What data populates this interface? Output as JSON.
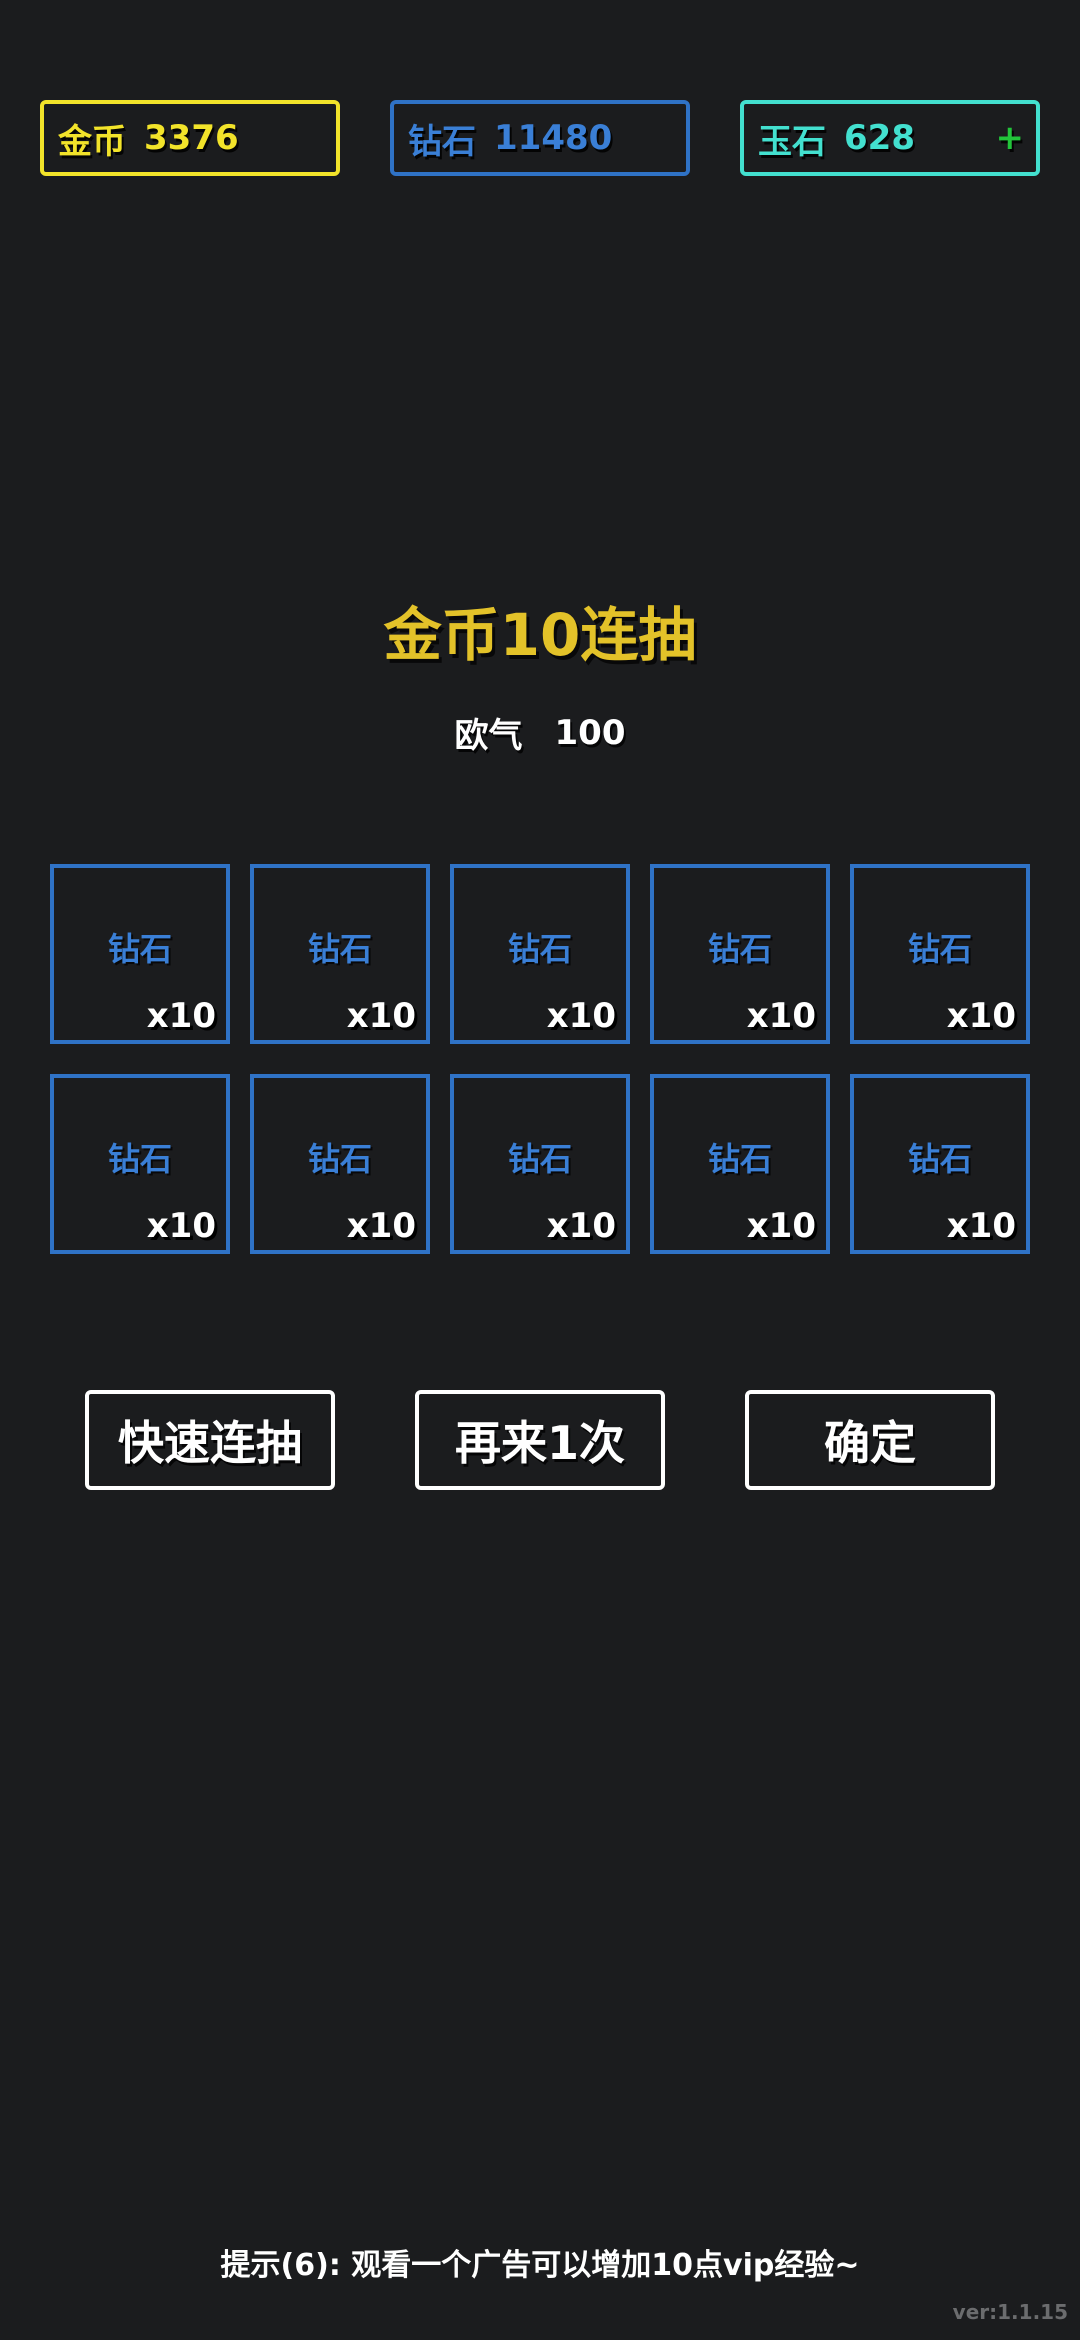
{
  "currencies": {
    "gold": {
      "label": "金币",
      "value": "3376",
      "color": "#f2e32a"
    },
    "diamond": {
      "label": "钻石",
      "value": "11480",
      "color": "#2f72c6"
    },
    "jade": {
      "label": "玉石",
      "value": "628",
      "color": "#43e0cf",
      "add": "+"
    }
  },
  "title": "金币10连抽",
  "luck": {
    "label": "欧气",
    "value": "100"
  },
  "rewards": [
    {
      "name": "钻石",
      "count": "x10"
    },
    {
      "name": "钻石",
      "count": "x10"
    },
    {
      "name": "钻石",
      "count": "x10"
    },
    {
      "name": "钻石",
      "count": "x10"
    },
    {
      "name": "钻石",
      "count": "x10"
    },
    {
      "name": "钻石",
      "count": "x10"
    },
    {
      "name": "钻石",
      "count": "x10"
    },
    {
      "name": "钻石",
      "count": "x10"
    },
    {
      "name": "钻石",
      "count": "x10"
    },
    {
      "name": "钻石",
      "count": "x10"
    }
  ],
  "buttons": {
    "fast": "快速连抽",
    "again": "再来1次",
    "confirm": "确定"
  },
  "tip": "提示(6): 观看一个广告可以增加10点vip经验~",
  "version": "ver:1.1.15",
  "theme": {
    "background": "#1b1c1e",
    "title_color": "#e3c229",
    "card_border": "#2f72c6",
    "plus_color": "#22c43a"
  }
}
